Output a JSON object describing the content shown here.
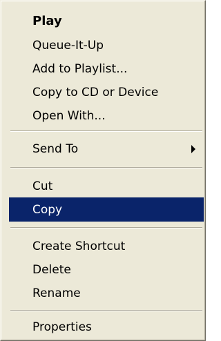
{
  "context_menu": {
    "items": [
      {
        "label": "Play"
      },
      {
        "label": "Queue-It-Up"
      },
      {
        "label": "Add to Playlist..."
      },
      {
        "label": "Copy to CD or Device"
      },
      {
        "label": "Open With..."
      },
      {
        "label": "Send To",
        "submenu_icon": "submenu-arrow-icon"
      },
      {
        "label": "Cut"
      },
      {
        "label": "Copy",
        "selected": true
      },
      {
        "label": "Create Shortcut"
      },
      {
        "label": "Delete"
      },
      {
        "label": "Rename"
      },
      {
        "label": "Properties"
      }
    ],
    "colors": {
      "background": "#ece9d8",
      "highlight": "#0a246a",
      "highlight_text": "#ffffff"
    }
  }
}
